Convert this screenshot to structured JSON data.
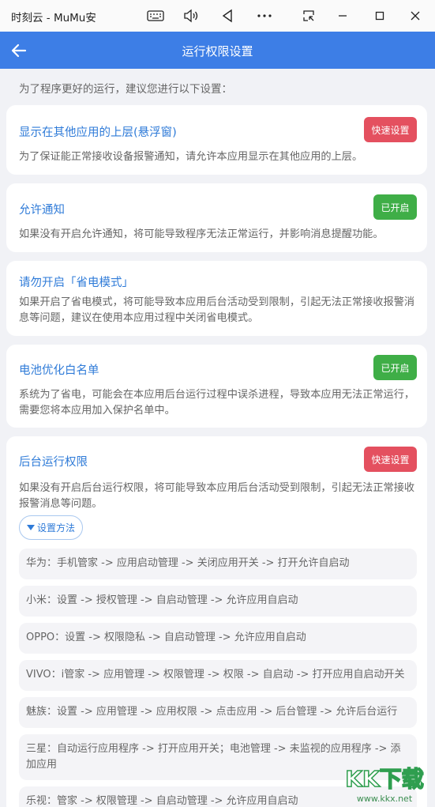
{
  "window": {
    "title": "时刻云 - MuMu安"
  },
  "header": {
    "title": "运行权限设置"
  },
  "intro": "为了程序更好的运行，建议您进行以下设置：",
  "cards": [
    {
      "title": "显示在其他应用的上层(悬浮窗)",
      "button": "快速设置",
      "status": "red",
      "desc": "为了保证能正常接收设备报警通知，请允许本应用显示在其他应用的上层。"
    },
    {
      "title": "允许通知",
      "button": "已开启",
      "status": "green",
      "desc": "如果没有开启允许通知，将可能导致程序无法正常运行，并影响消息提醒功能。"
    },
    {
      "title": "请勿开启「省电模式」",
      "button": "",
      "desc": "如果开启了省电模式，将可能导致本应用后台活动受到限制，引起无法正常接收报警消息等问题，建议在使用本应用过程中关闭省电模式。"
    },
    {
      "title": "电池优化白名单",
      "button": "已开启",
      "status": "green",
      "desc": "系统为了省电，可能会在本应用后台运行过程中误杀进程，导致本应用无法正常运行，需要您将本应用加入保护名单中。"
    },
    {
      "title": "后台运行权限",
      "button": "快速设置",
      "status": "red",
      "desc": "如果没有开启后台运行权限，将可能导致本应用后台活动受到限制，引起无法正常接收报警消息等问题。"
    }
  ],
  "method_button": "设置方法",
  "steps": [
    "华为：手机管家 -> 应用启动管理 -> 关闭应用开关 -> 打开允许自启动",
    "小米：设置 -> 授权管理 -> 自启动管理 -> 允许应用自启动",
    "OPPO：设置 -> 权限隐私 -> 自启动管理 -> 允许应用自启动",
    "VIVO：i管家 -> 应用管理 -> 权限管理 -> 权限 -> 自启动 -> 打开应用自启动开关",
    "魅族：设置 -> 应用管理 -> 应用权限 -> 点击应用 -> 后台管理 -> 允许后台运行",
    "三星：自动运行应用程序 -> 打开应用开关；电池管理 -> 未监视的应用程序 -> 添加应用",
    "乐视：管家 -> 权限管理 -> 自启动管理 -> 允许应用自启动"
  ],
  "colors": {
    "header": "#3d7ee6",
    "title": "#2f7bd8",
    "red_button": "#e4505f",
    "green_button": "#3fae47"
  },
  "watermark": {
    "main": "KK下载",
    "sub": "www.kkx.net"
  }
}
